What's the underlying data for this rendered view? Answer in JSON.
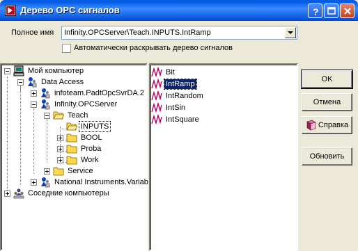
{
  "window": {
    "title": "Дерево OPC сигналов"
  },
  "full_name": {
    "label": "Полное имя",
    "value": "Infinity.OPCServer\\Teach.INPUTS.IntRamp"
  },
  "auto_expand": {
    "label": "Автоматически раскрывать дерево сигналов",
    "checked": false
  },
  "tree": {
    "my_computer": "Мой компьютер",
    "data_access": "Data Access",
    "infoteam": "infoteam.PadtOpcSvrDA.2",
    "infinity": "Infinity.OPCServer",
    "teach": "Teach",
    "inputs": "INPUTS",
    "bool": "BOOL",
    "proba": "Proba",
    "work": "Work",
    "service": "Service",
    "national": "National Instruments.Variab",
    "neighbors": "Соседние компьютеры"
  },
  "signals": [
    "Bit",
    "IntRamp",
    "IntRandom",
    "IntSin",
    "IntSquare"
  ],
  "selected_signal": "IntRamp",
  "buttons": {
    "ok": "OK",
    "cancel": "Отмена",
    "help": "Справка",
    "refresh": "Обновить"
  },
  "colors": {
    "titlebar": "#0058e6",
    "selection": "#0a246a",
    "folder": "#ffd84c",
    "signal_icon": "#b00060"
  }
}
